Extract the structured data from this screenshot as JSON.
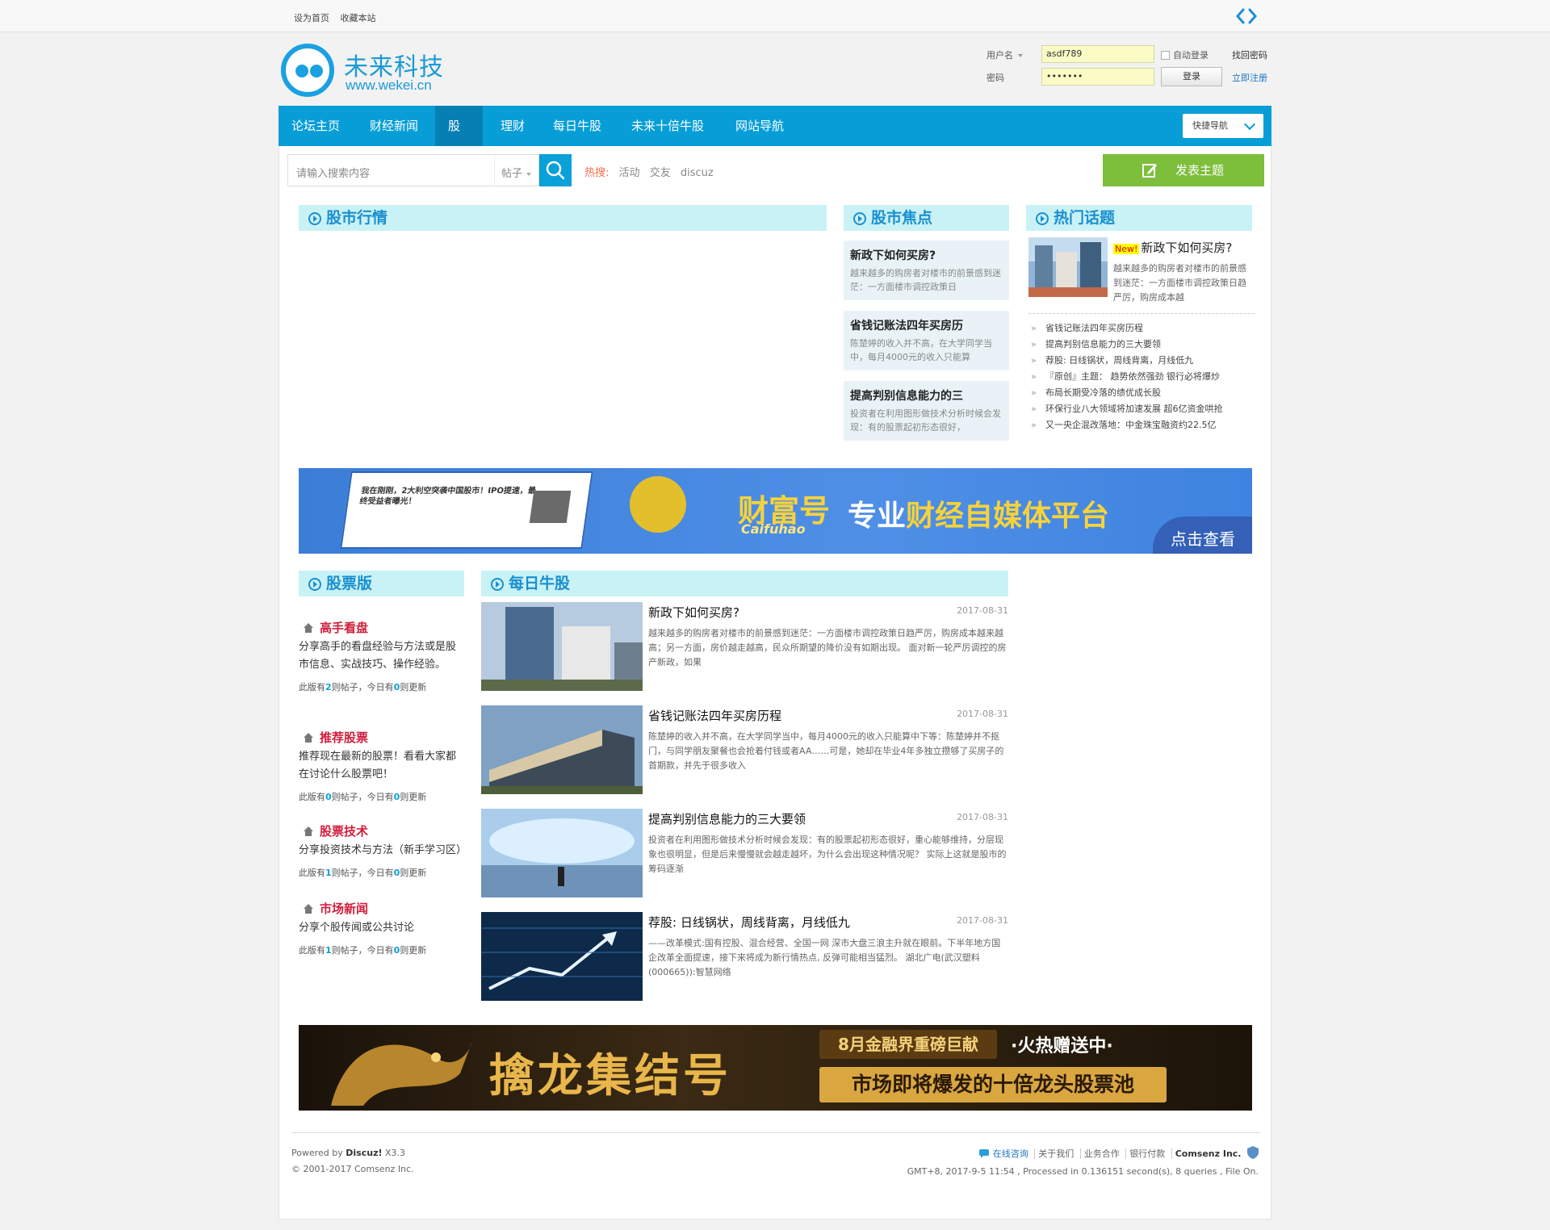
{
  "topbar": {
    "set_home": "设为首页",
    "bookmark": "收藏本站"
  },
  "logo": {
    "title": "未来科技",
    "subtitle": "www.wekei.cn"
  },
  "login": {
    "username_label": "用户名",
    "password_label": "密码",
    "username_value": "asdf789",
    "password_value": "•••••••",
    "auto_login": "自动登录",
    "login_button": "登录",
    "find_password": "找回密码",
    "register": "立即注册"
  },
  "nav": {
    "items": [
      "论坛主页",
      "财经新闻",
      "股票",
      "理财",
      "每日牛股",
      "未来十倍牛股",
      "网站导航"
    ],
    "active": "股票",
    "quick_nav": "快捷导航"
  },
  "search": {
    "placeholder": "请输入搜索内容",
    "type": "帖子",
    "hot_label": "热搜:",
    "hot_terms": [
      "活动",
      "交友",
      "discuz"
    ],
    "post_button": "发表主题"
  },
  "sections": {
    "market": "股市行情",
    "focus": "股市焦点",
    "hot": "热门话题",
    "boards": "股票版",
    "daily": "每日牛股"
  },
  "focus_cards": [
    {
      "title": "新政下如何买房?",
      "desc": "越来越多的购房者对楼市的前景感到迷茫：一方面楼市调控政策日"
    },
    {
      "title": "省钱记账法四年买房历",
      "desc": "陈楚婷的收入并不高，在大学同学当中，每月4000元的收入只能算"
    },
    {
      "title": "提高判别信息能力的三",
      "desc": "投资者在利用图形做技术分析时候会发现：有的股票起初形态很好，"
    }
  ],
  "hot_feature": {
    "badge": "New!",
    "title": "新政下如何买房?",
    "desc": "越来越多的购房者对楼市的前景感到迷茫：一方面楼市调控政策日趋严厉，购房成本越"
  },
  "hot_list": [
    "省钱记账法四年买房历程",
    "提高判别信息能力的三大要领",
    "荐股: 日线锅状，周线背离，月线低九",
    "『原创』主题： 趋势依然强劲 银行必将爆炒",
    "布局长期受冷落的绩优成长股",
    "环保行业八大领域将加速发展 超6亿资金哄抢",
    "又一央企混改落地：中金珠宝融资约22.5亿"
  ],
  "banner1": {
    "headline": "财富号",
    "sub": "Caifuhao",
    "slogan_a": "专业",
    "slogan_b": "财经自媒体平台",
    "cta": "点击查看",
    "mock_headline": "我在刚刚，2大利空突袭中国股市！IPO提速，最终受益者曝光！"
  },
  "boards": [
    {
      "name": "高手看盘",
      "desc": "分享高手的看盘经验与方法或是股市信息、实战技巧、操作经验。",
      "posts": "2",
      "today": "0"
    },
    {
      "name": "推荐股票",
      "desc": "推荐现在最新的股票！看看大家都在讨论什么股票吧！",
      "posts": "0",
      "today": "0"
    },
    {
      "name": "股票技术",
      "desc": "分享投资技术与方法（新手学习区）",
      "posts": "1",
      "today": "0"
    },
    {
      "name": "市场新闻",
      "desc": "分享个股传闻或公共讨论",
      "posts": "1",
      "today": "0"
    }
  ],
  "board_stat": {
    "prefix": "此版有",
    "mid": "则帖子，今日有",
    "suffix": "则更新"
  },
  "news": [
    {
      "title": "新政下如何买房?",
      "date": "2017-08-31",
      "desc": "越来越多的购房者对楼市的前景感到迷茫：一方面楼市调控政策日趋严厉，购房成本越来越高；另一方面，房价越走越高，民众所期望的降价没有如期出现。 面对新一轮严厉调控的房产新政，如果"
    },
    {
      "title": "省钱记账法四年买房历程",
      "date": "2017-08-31",
      "desc": "陈楚婷的收入并不高，在大学同学当中，每月4000元的收入只能算中下等：陈楚婷并不抠门，与同学朋友聚餐也会抢着付钱或者AA……可是，她却在毕业4年多独立攒够了买房子的首期款，并先于很多收入"
    },
    {
      "title": "提高判别信息能力的三大要领",
      "date": "2017-08-31",
      "desc": "投资者在利用图形做技术分析时候会发现：有的股票起初形态很好，重心能够维持，分层现象也很明显，但是后来慢慢就会越走越坏，为什么会出现这种情况呢？ 实际上这就是股市的筹码逐渐"
    },
    {
      "title": "荐股: 日线锅状，周线背离，月线低九",
      "date": "2017-08-31",
      "desc": "——改革模式:国有控股、混合经营、全国一网 深市大盘三浪主升就在眼前。下半年地方国企改革全面提速，接下来将成为新行情热点, 反弹可能相当猛烈。 湖北广电(武汉塑料(000665)):智慧网络"
    }
  ],
  "banner2": {
    "calligraphy": "擒龙集结号",
    "top": "8月金融界重磅巨献",
    "hot": "·火热赠送中·",
    "bottom": "市场即将爆发的十倍龙头股票池"
  },
  "footer": {
    "powered_prefix": "Powered by ",
    "powered_name": "Discuz!",
    "powered_ver": " X3.3",
    "copyright": "© 2001-2017 Comsenz Inc.",
    "consult": "在线咨询",
    "links": [
      "关于我们",
      "业务合作",
      "银行付款"
    ],
    "company": "Comsenz Inc.",
    "stats": "GMT+8, 2017-9-5 11:54 , Processed in 0.136151 second(s), 8 queries , File On."
  },
  "colors": {
    "brand": "#079ed7",
    "nav_active": "#0680b3",
    "section_bg": "#c9f2f6",
    "post_green": "#7dbe3b",
    "board_red": "#d01f3c"
  }
}
